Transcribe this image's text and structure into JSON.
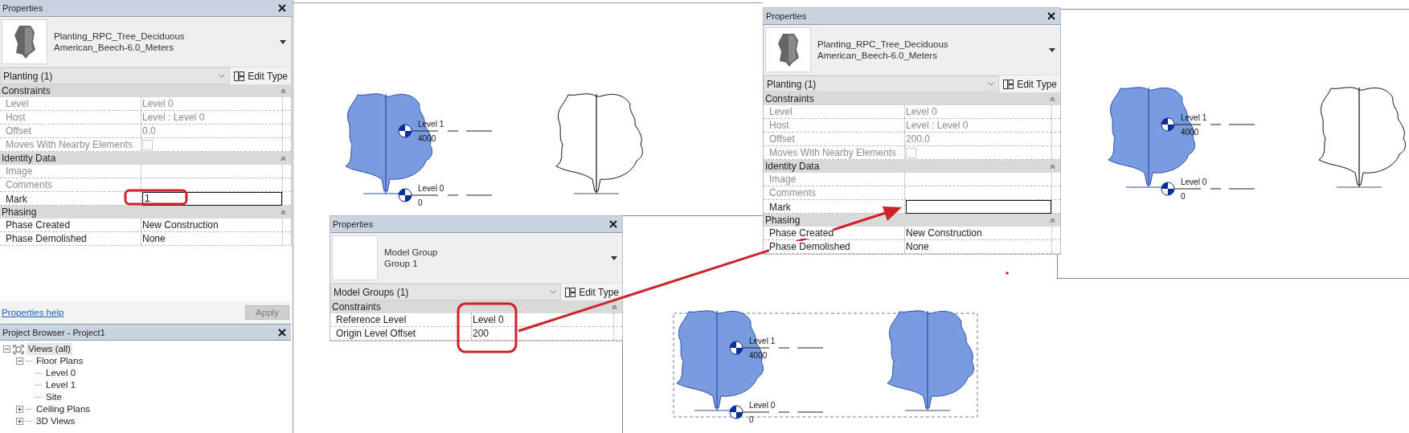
{
  "properties_panels": [
    {
      "title": "Properties",
      "type_selector": {
        "kind": "tree",
        "lines": [
          "Planting_RPC_Tree_Deciduous",
          "American_Beech-6.0_Meters"
        ]
      },
      "category": "Planting (1)",
      "edit_type": "Edit Type",
      "sections": [
        {
          "title": "Constraints",
          "expanded": true,
          "rows": [
            {
              "label": "Level",
              "value": "Level 0",
              "kind": "text",
              "disabled": true
            },
            {
              "label": "Host",
              "value": "Level : Level 0",
              "kind": "text",
              "disabled": true
            },
            {
              "label": "Offset",
              "value": "0.0",
              "kind": "text",
              "disabled": true
            },
            {
              "label": "Moves With Nearby Elements",
              "kind": "checkbox",
              "checked": false,
              "disabled": true
            }
          ]
        },
        {
          "title": "Identity Data",
          "expanded": true,
          "rows": [
            {
              "label": "Image",
              "kind": "text",
              "disabled": true
            },
            {
              "label": "Comments",
              "kind": "text",
              "disabled": true
            },
            {
              "label": "Mark",
              "value": "1",
              "kind": "field",
              "disabled": false
            }
          ]
        },
        {
          "title": "Phasing",
          "expanded": true,
          "rows": [
            {
              "label": "Phase Created",
              "value": "New Construction",
              "kind": "text",
              "disabled": false
            },
            {
              "label": "Phase Demolished",
              "value": "None",
              "kind": "text",
              "disabled": false
            }
          ]
        }
      ]
    },
    {
      "title": "Properties",
      "type_selector": {
        "kind": "blank",
        "lines": [
          "Model Group",
          "Group 1"
        ]
      },
      "category": "Model Groups (1)",
      "edit_type": "Edit Type",
      "sections": [
        {
          "title": "Constraints",
          "expanded": true,
          "rows": [
            {
              "label": "Reference Level",
              "value": "Level 0",
              "kind": "text",
              "disabled": false
            },
            {
              "label": "Origin Level Offset",
              "value": "200",
              "kind": "text",
              "disabled": false
            }
          ]
        }
      ]
    },
    {
      "title": "Properties",
      "type_selector": {
        "kind": "tree",
        "lines": [
          "Planting_RPC_Tree_Deciduous",
          "American_Beech-6.0_Meters"
        ]
      },
      "category": "Planting (1)",
      "edit_type": "Edit Type",
      "sections": [
        {
          "title": "Constraints",
          "expanded": true,
          "rows": [
            {
              "label": "Level",
              "value": "Level 0",
              "kind": "text",
              "disabled": true
            },
            {
              "label": "Host",
              "value": "Level : Level 0",
              "kind": "text",
              "disabled": true
            },
            {
              "label": "Offset",
              "value": "200.0",
              "kind": "text",
              "disabled": true
            },
            {
              "label": "Moves With Nearby Elements",
              "kind": "checkbox",
              "checked": false,
              "disabled": true
            }
          ]
        },
        {
          "title": "Identity Data",
          "expanded": true,
          "rows": [
            {
              "label": "Image",
              "kind": "text",
              "disabled": true
            },
            {
              "label": "Comments",
              "kind": "text",
              "disabled": true
            },
            {
              "label": "Mark",
              "kind": "field",
              "disabled": false
            }
          ]
        },
        {
          "title": "Phasing",
          "expanded": true,
          "rows": [
            {
              "label": "Phase Created",
              "value": "New Construction",
              "kind": "text",
              "disabled": false
            },
            {
              "label": "Phase Demolished",
              "value": "None",
              "kind": "text",
              "disabled": false
            }
          ]
        }
      ]
    }
  ],
  "properties_help": "Properties help",
  "apply_button": {
    "label": "Apply",
    "disabled": true
  },
  "project_browser": {
    "title": "Project Browser - Project1",
    "tree": [
      {
        "label": "Views (all)",
        "selected": true,
        "expanded": true,
        "children": [
          {
            "label": "Floor Plans",
            "selected": false,
            "expanded": true,
            "children": [
              {
                "label": "Level 0",
                "selected": false
              },
              {
                "label": "Level 1",
                "selected": false
              },
              {
                "label": "Site",
                "selected": false
              }
            ]
          },
          {
            "label": "Ceiling Plans",
            "selected": false,
            "expanded": false
          },
          {
            "label": "3D Views",
            "selected": false,
            "expanded": false
          }
        ]
      }
    ]
  },
  "views": [
    {
      "trees": [
        {
          "selected": true
        },
        {
          "selected": false
        }
      ],
      "levels": [
        {
          "name": "Level 1",
          "elevation": "4000"
        },
        {
          "name": "Level 0",
          "elevation": "0"
        }
      ]
    },
    {
      "trees": [
        {
          "selected": true
        },
        {
          "selected": false
        }
      ],
      "levels": [
        {
          "name": "Level 1",
          "elevation": "4000"
        },
        {
          "name": "Level 0",
          "elevation": "0"
        }
      ]
    },
    {
      "selection_box": true,
      "trees": [
        {
          "selected": true
        },
        {
          "selected": true
        }
      ],
      "levels": [
        {
          "name": "Level 1",
          "elevation": "4000"
        },
        {
          "name": "Level 0",
          "elevation": "0"
        }
      ]
    }
  ]
}
